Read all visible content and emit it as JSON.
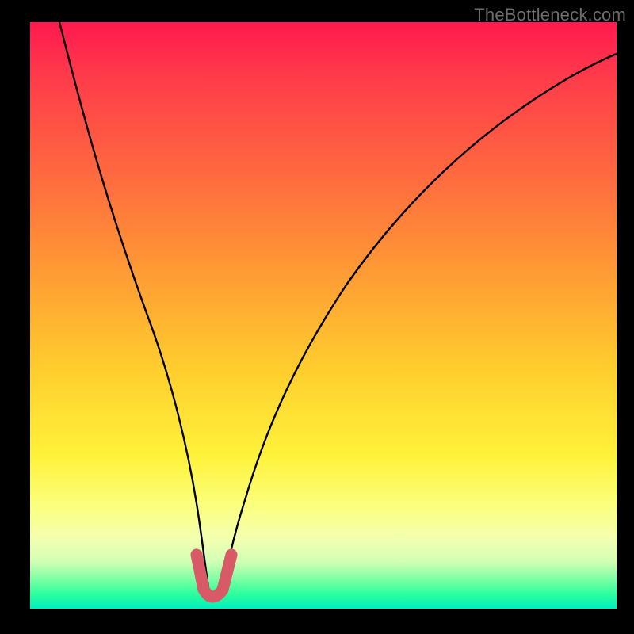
{
  "watermark": {
    "text": "TheBottleneck.com"
  },
  "colors": {
    "curve": "#000000",
    "accent": "#d85a66",
    "frame_bg": "#000000"
  },
  "chart_data": {
    "type": "line",
    "title": "",
    "xlabel": "",
    "ylabel": "",
    "xlim": [
      0,
      100
    ],
    "ylim": [
      0,
      100
    ],
    "grid": false,
    "legend": false,
    "series": [
      {
        "name": "bottleneck-curve",
        "x": [
          5,
          8,
          12,
          16,
          20,
          23,
          25,
          27,
          28.5,
          30,
          31.5,
          33,
          35,
          38,
          42,
          48,
          55,
          63,
          72,
          82,
          92,
          100
        ],
        "y": [
          100,
          88,
          72,
          56,
          40,
          26,
          16,
          8,
          3,
          1,
          3,
          8,
          16,
          27,
          40,
          53,
          64,
          73,
          80,
          86,
          90,
          93
        ]
      },
      {
        "name": "valley-highlight",
        "x": [
          27,
          28.5,
          30,
          31.5,
          33
        ],
        "y": [
          8,
          3,
          1,
          3,
          8
        ]
      }
    ],
    "annotations": []
  }
}
